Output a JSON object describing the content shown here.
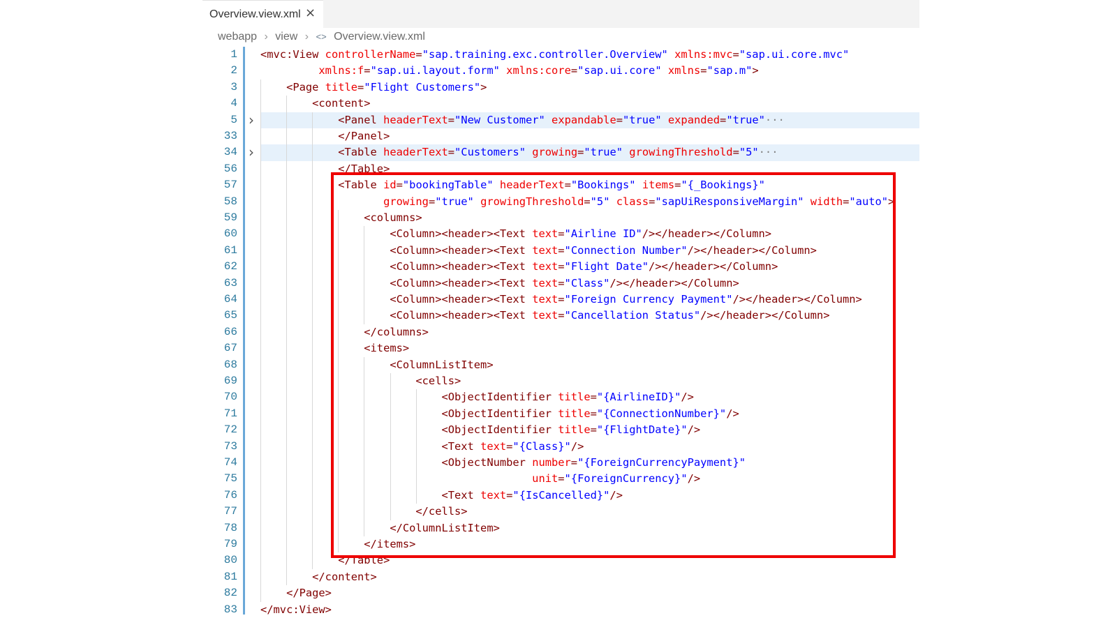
{
  "tab": {
    "label": "Overview.view.xml",
    "close": "×"
  },
  "breadcrumb": [
    "webapp",
    "view",
    "Overview.view.xml"
  ],
  "lines": [
    {
      "n": "1",
      "indent": 0,
      "tokens": [
        [
          "t",
          "<mvc:View "
        ],
        [
          "a",
          "controllerName"
        ],
        [
          "t",
          "="
        ],
        [
          "v",
          "\"sap.training.exc.controller.Overview\""
        ],
        [
          "t",
          " "
        ],
        [
          "a",
          "xmlns:mvc"
        ],
        [
          "t",
          "="
        ],
        [
          "v",
          "\"sap.ui.core.mvc\""
        ]
      ]
    },
    {
      "n": "2",
      "indent": 0,
      "pad": "         ",
      "tokens": [
        [
          "a",
          "xmlns:f"
        ],
        [
          "t",
          "="
        ],
        [
          "v",
          "\"sap.ui.layout.form\""
        ],
        [
          "t",
          " "
        ],
        [
          "a",
          "xmlns:core"
        ],
        [
          "t",
          "="
        ],
        [
          "v",
          "\"sap.ui.core\""
        ],
        [
          "t",
          " "
        ],
        [
          "a",
          "xmlns"
        ],
        [
          "t",
          "="
        ],
        [
          "v",
          "\"sap.m\""
        ],
        [
          "t",
          ">"
        ]
      ]
    },
    {
      "n": "3",
      "indent": 1,
      "tokens": [
        [
          "t",
          "<Page "
        ],
        [
          "a",
          "title"
        ],
        [
          "t",
          "="
        ],
        [
          "v",
          "\"Flight Customers\""
        ],
        [
          "t",
          ">"
        ]
      ]
    },
    {
      "n": "4",
      "indent": 2,
      "tokens": [
        [
          "t",
          "<content>"
        ]
      ]
    },
    {
      "n": "5",
      "indent": 3,
      "fold": true,
      "hl": true,
      "tokens": [
        [
          "t",
          "<Panel "
        ],
        [
          "a",
          "headerText"
        ],
        [
          "t",
          "="
        ],
        [
          "v",
          "\"New Customer\""
        ],
        [
          "t",
          " "
        ],
        [
          "a",
          "expandable"
        ],
        [
          "t",
          "="
        ],
        [
          "v",
          "\"true\""
        ],
        [
          "t",
          " "
        ],
        [
          "a",
          "expanded"
        ],
        [
          "t",
          "="
        ],
        [
          "v",
          "\"true\""
        ],
        [
          "e",
          "···"
        ]
      ]
    },
    {
      "n": "33",
      "indent": 3,
      "tokens": [
        [
          "t",
          "</Panel>"
        ]
      ]
    },
    {
      "n": "34",
      "indent": 3,
      "fold": true,
      "hl": true,
      "tokens": [
        [
          "t",
          "<Table "
        ],
        [
          "a",
          "headerText"
        ],
        [
          "t",
          "="
        ],
        [
          "v",
          "\"Customers\""
        ],
        [
          "t",
          " "
        ],
        [
          "a",
          "growing"
        ],
        [
          "t",
          "="
        ],
        [
          "v",
          "\"true\""
        ],
        [
          "t",
          " "
        ],
        [
          "a",
          "growingThreshold"
        ],
        [
          "t",
          "="
        ],
        [
          "v",
          "\"5\""
        ],
        [
          "e",
          "···"
        ]
      ]
    },
    {
      "n": "56",
      "indent": 3,
      "tokens": [
        [
          "t",
          "</Table>"
        ]
      ]
    },
    {
      "n": "57",
      "indent": 3,
      "tokens": [
        [
          "t",
          "<Table "
        ],
        [
          "a",
          "id"
        ],
        [
          "t",
          "="
        ],
        [
          "v",
          "\"bookingTable\""
        ],
        [
          "t",
          " "
        ],
        [
          "a",
          "headerText"
        ],
        [
          "t",
          "="
        ],
        [
          "v",
          "\"Bookings\""
        ],
        [
          "t",
          " "
        ],
        [
          "a",
          "items"
        ],
        [
          "t",
          "="
        ],
        [
          "v",
          "\"{_Bookings}\""
        ]
      ]
    },
    {
      "n": "58",
      "indent": 3,
      "pad": "       ",
      "tokens": [
        [
          "a",
          "growing"
        ],
        [
          "t",
          "="
        ],
        [
          "v",
          "\"true\""
        ],
        [
          "t",
          " "
        ],
        [
          "a",
          "growingThreshold"
        ],
        [
          "t",
          "="
        ],
        [
          "v",
          "\"5\""
        ],
        [
          "t",
          " "
        ],
        [
          "a",
          "class"
        ],
        [
          "t",
          "="
        ],
        [
          "v",
          "\"sapUiResponsiveMargin\""
        ],
        [
          "t",
          " "
        ],
        [
          "a",
          "width"
        ],
        [
          "t",
          "="
        ],
        [
          "v",
          "\"auto\""
        ],
        [
          "t",
          ">"
        ]
      ]
    },
    {
      "n": "59",
      "indent": 4,
      "tokens": [
        [
          "t",
          "<columns>"
        ]
      ]
    },
    {
      "n": "60",
      "indent": 5,
      "tokens": [
        [
          "t",
          "<Column><header><Text "
        ],
        [
          "a",
          "text"
        ],
        [
          "t",
          "="
        ],
        [
          "v",
          "\"Airline ID\""
        ],
        [
          "t",
          "/></header></Column>"
        ]
      ]
    },
    {
      "n": "61",
      "indent": 5,
      "tokens": [
        [
          "t",
          "<Column><header><Text "
        ],
        [
          "a",
          "text"
        ],
        [
          "t",
          "="
        ],
        [
          "v",
          "\"Connection Number\""
        ],
        [
          "t",
          "/></header></Column>"
        ]
      ]
    },
    {
      "n": "62",
      "indent": 5,
      "tokens": [
        [
          "t",
          "<Column><header><Text "
        ],
        [
          "a",
          "text"
        ],
        [
          "t",
          "="
        ],
        [
          "v",
          "\"Flight Date\""
        ],
        [
          "t",
          "/></header></Column>"
        ]
      ]
    },
    {
      "n": "63",
      "indent": 5,
      "tokens": [
        [
          "t",
          "<Column><header><Text "
        ],
        [
          "a",
          "text"
        ],
        [
          "t",
          "="
        ],
        [
          "v",
          "\"Class\""
        ],
        [
          "t",
          "/></header></Column>"
        ]
      ]
    },
    {
      "n": "64",
      "indent": 5,
      "tokens": [
        [
          "t",
          "<Column><header><Text "
        ],
        [
          "a",
          "text"
        ],
        [
          "t",
          "="
        ],
        [
          "v",
          "\"Foreign Currency Payment\""
        ],
        [
          "t",
          "/></header></Column>"
        ]
      ]
    },
    {
      "n": "65",
      "indent": 5,
      "tokens": [
        [
          "t",
          "<Column><header><Text "
        ],
        [
          "a",
          "text"
        ],
        [
          "t",
          "="
        ],
        [
          "v",
          "\"Cancellation Status\""
        ],
        [
          "t",
          "/></header></Column>"
        ]
      ]
    },
    {
      "n": "66",
      "indent": 4,
      "tokens": [
        [
          "t",
          "</columns>"
        ]
      ]
    },
    {
      "n": "67",
      "indent": 4,
      "tokens": [
        [
          "t",
          "<items>"
        ]
      ]
    },
    {
      "n": "68",
      "indent": 5,
      "tokens": [
        [
          "t",
          "<ColumnListItem>"
        ]
      ]
    },
    {
      "n": "69",
      "indent": 6,
      "tokens": [
        [
          "t",
          "<cells>"
        ]
      ]
    },
    {
      "n": "70",
      "indent": 7,
      "tokens": [
        [
          "t",
          "<ObjectIdentifier "
        ],
        [
          "a",
          "title"
        ],
        [
          "t",
          "="
        ],
        [
          "v",
          "\"{AirlineID}\""
        ],
        [
          "t",
          "/>"
        ]
      ]
    },
    {
      "n": "71",
      "indent": 7,
      "tokens": [
        [
          "t",
          "<ObjectIdentifier "
        ],
        [
          "a",
          "title"
        ],
        [
          "t",
          "="
        ],
        [
          "v",
          "\"{ConnectionNumber}\""
        ],
        [
          "t",
          "/>"
        ]
      ]
    },
    {
      "n": "72",
      "indent": 7,
      "tokens": [
        [
          "t",
          "<ObjectIdentifier "
        ],
        [
          "a",
          "title"
        ],
        [
          "t",
          "="
        ],
        [
          "v",
          "\"{FlightDate}\""
        ],
        [
          "t",
          "/>"
        ]
      ]
    },
    {
      "n": "73",
      "indent": 7,
      "tokens": [
        [
          "t",
          "<Text "
        ],
        [
          "a",
          "text"
        ],
        [
          "t",
          "="
        ],
        [
          "v",
          "\"{Class}\""
        ],
        [
          "t",
          "/>"
        ]
      ]
    },
    {
      "n": "74",
      "indent": 7,
      "tokens": [
        [
          "t",
          "<ObjectNumber "
        ],
        [
          "a",
          "number"
        ],
        [
          "t",
          "="
        ],
        [
          "v",
          "\"{ForeignCurrencyPayment}\""
        ]
      ]
    },
    {
      "n": "75",
      "indent": 7,
      "pad": "              ",
      "tokens": [
        [
          "a",
          "unit"
        ],
        [
          "t",
          "="
        ],
        [
          "v",
          "\"{ForeignCurrency}\""
        ],
        [
          "t",
          "/>"
        ]
      ]
    },
    {
      "n": "76",
      "indent": 7,
      "tokens": [
        [
          "t",
          "<Text "
        ],
        [
          "a",
          "text"
        ],
        [
          "t",
          "="
        ],
        [
          "v",
          "\"{IsCancelled}\""
        ],
        [
          "t",
          "/>"
        ]
      ]
    },
    {
      "n": "77",
      "indent": 6,
      "tokens": [
        [
          "t",
          "</cells>"
        ]
      ]
    },
    {
      "n": "78",
      "indent": 5,
      "tokens": [
        [
          "t",
          "</ColumnListItem>"
        ]
      ]
    },
    {
      "n": "79",
      "indent": 4,
      "tokens": [
        [
          "t",
          "</items>"
        ]
      ]
    },
    {
      "n": "80",
      "indent": 3,
      "tokens": [
        [
          "t",
          "</Table>"
        ]
      ]
    },
    {
      "n": "81",
      "indent": 2,
      "tokens": [
        [
          "t",
          "</content>"
        ]
      ]
    },
    {
      "n": "82",
      "indent": 1,
      "tokens": [
        [
          "t",
          "</Page>"
        ]
      ]
    },
    {
      "n": "83",
      "indent": 0,
      "tokens": [
        [
          "t",
          "</mvc:View>"
        ]
      ]
    }
  ],
  "colors": {
    "tag": "#800000",
    "attribute": "#ee0000",
    "value": "#0000ff",
    "line_number": "#2c7a9e",
    "highlight_box": "#ee0000"
  },
  "icons": {
    "fold": "chevron-right-icon",
    "close": "close-icon",
    "breadcrumb_file": "xml-file-icon"
  }
}
